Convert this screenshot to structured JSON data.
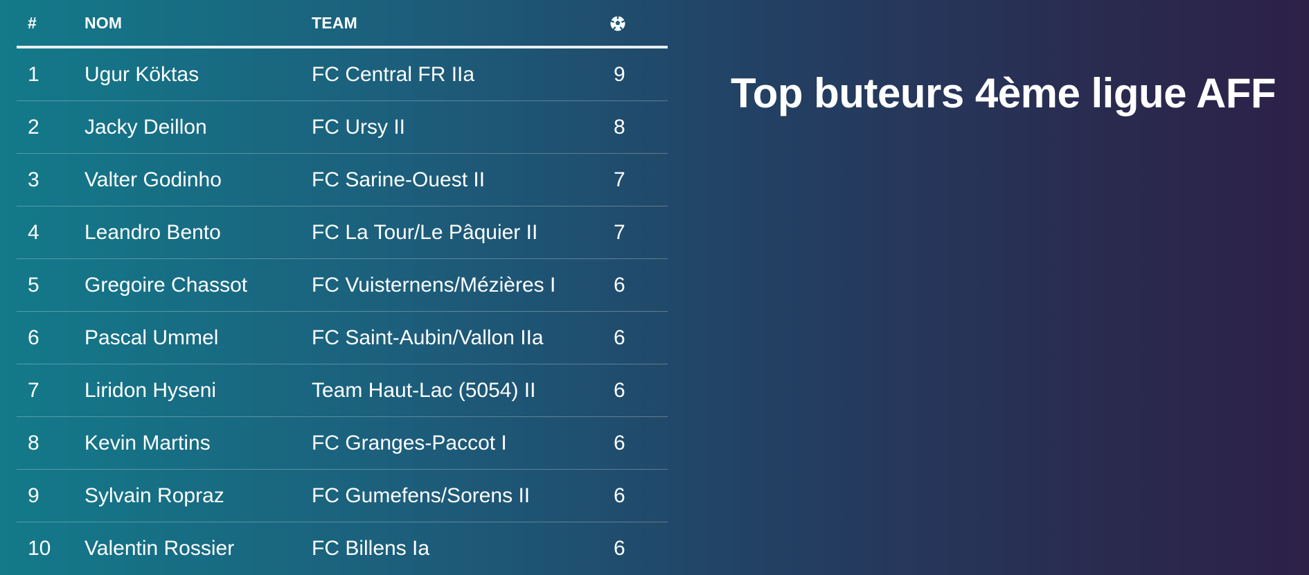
{
  "title": "Top buteurs 4ème ligue AFF",
  "table": {
    "headers": {
      "rank": "#",
      "name": "NOM",
      "team": "TEAM",
      "goals_icon": "soccer-ball-icon"
    },
    "rows": [
      {
        "rank": "1",
        "name": "Ugur Köktas",
        "team": "FC Central FR IIa",
        "goals": "9"
      },
      {
        "rank": "2",
        "name": "Jacky Deillon",
        "team": "FC Ursy II",
        "goals": "8"
      },
      {
        "rank": "3",
        "name": "Valter Godinho",
        "team": "FC Sarine-Ouest II",
        "goals": "7"
      },
      {
        "rank": "4",
        "name": "Leandro Bento",
        "team": "FC La Tour/Le Pâquier II",
        "goals": "7"
      },
      {
        "rank": "5",
        "name": "Gregoire Chassot",
        "team": "FC Vuisternens/Mézières I",
        "goals": "6"
      },
      {
        "rank": "6",
        "name": "Pascal Ummel",
        "team": "FC Saint-Aubin/Vallon IIa",
        "goals": "6"
      },
      {
        "rank": "7",
        "name": "Liridon Hyseni",
        "team": "Team Haut-Lac (5054) II",
        "goals": "6"
      },
      {
        "rank": "8",
        "name": "Kevin Martins",
        "team": "FC Granges-Paccot I",
        "goals": "6"
      },
      {
        "rank": "9",
        "name": "Sylvain Ropraz",
        "team": "FC Gumefens/Sorens II",
        "goals": "6"
      },
      {
        "rank": "10",
        "name": "Valentin Rossier",
        "team": "FC Billens Ia",
        "goals": "6"
      }
    ]
  },
  "colors": {
    "gradient_start": "#137a8a",
    "gradient_end": "#2d2148",
    "text": "#ffffff",
    "header_rule": "#e9eef2"
  }
}
